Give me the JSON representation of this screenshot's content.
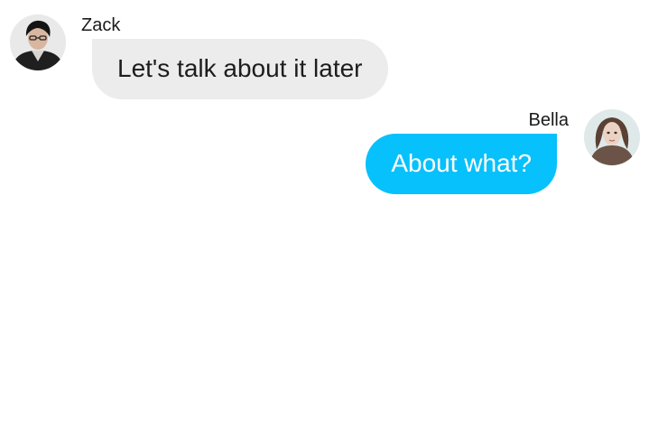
{
  "messages": [
    {
      "sender": "Zack",
      "text": "Let's talk about it later",
      "side": "left",
      "avatar_icon": "male-user-avatar-icon",
      "bubble_color": "#ececec"
    },
    {
      "sender": "Bella",
      "text": "About what?",
      "side": "right",
      "avatar_icon": "female-user-avatar-icon",
      "bubble_color": "#06c1fb"
    }
  ]
}
